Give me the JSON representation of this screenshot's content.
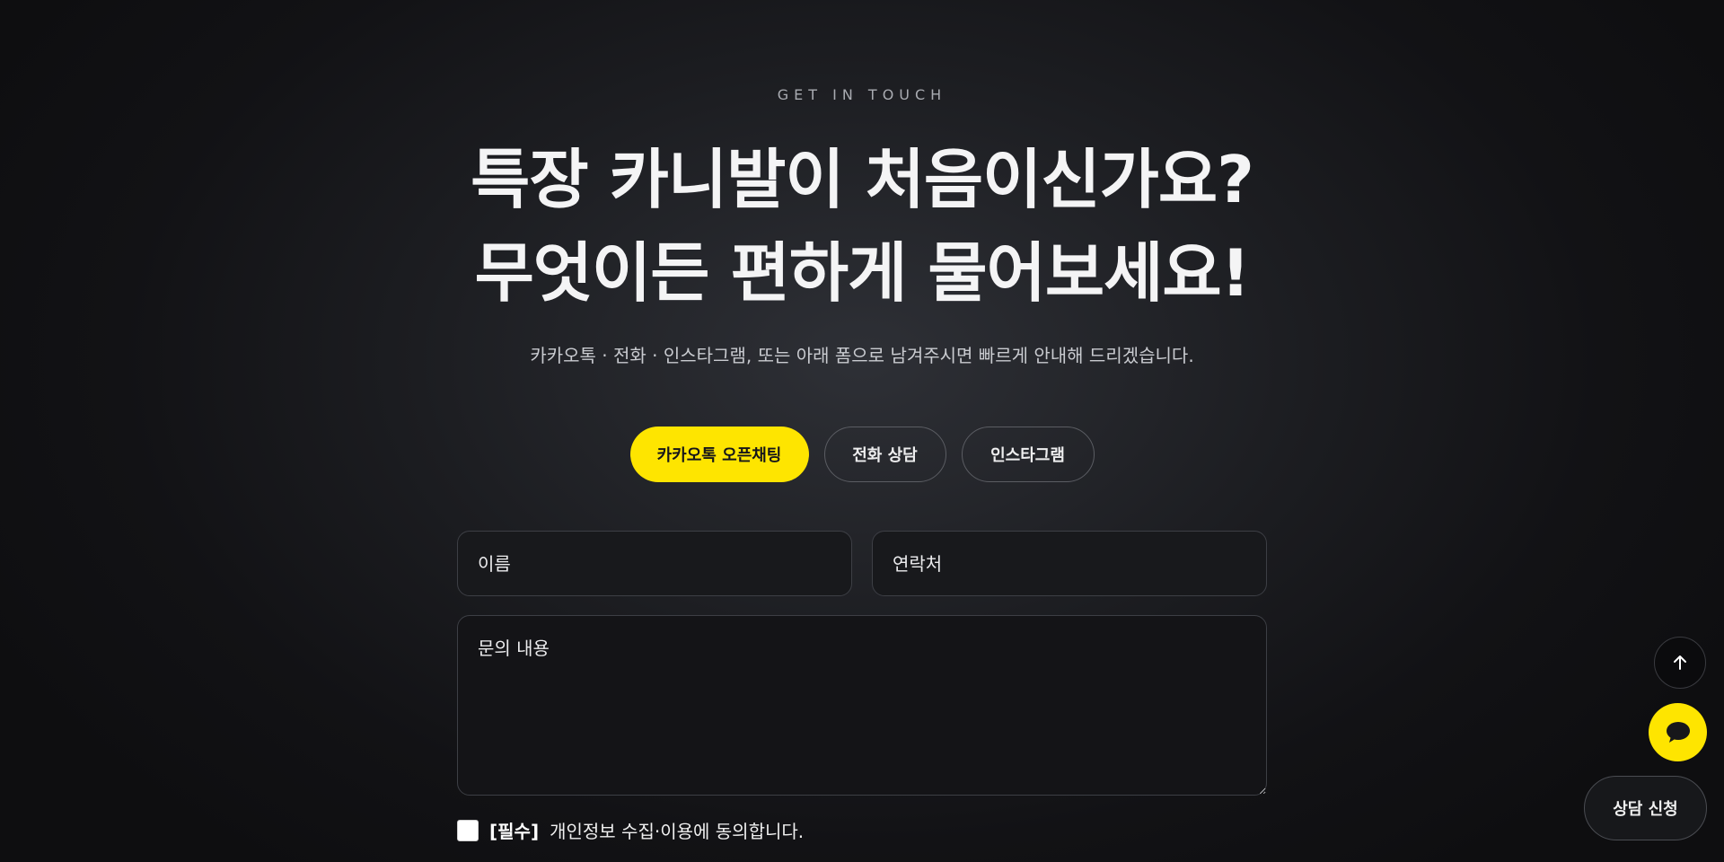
{
  "hero": {
    "eyebrow": "GET IN TOUCH",
    "headline_line1": "특장 카니발이 처음이신가요?",
    "headline_line2": "무엇이든 편하게 물어보세요!",
    "subtitle": "카카오톡 · 전화 · 인스타그램, 또는 아래 폼으로 남겨주시면 빠르게 안내해 드리겠습니다."
  },
  "channels": {
    "kakao_label": "카카오톡 오픈채팅",
    "phone_label": "전화 상담",
    "instagram_label": "인스타그램"
  },
  "form": {
    "name_placeholder": "이름",
    "contact_placeholder": "연락처",
    "message_placeholder": "문의 내용",
    "consent_required": "[필수]",
    "consent_text": "개인정보 수집·이용에 동의합니다.",
    "consent_checked": false
  },
  "floating": {
    "scroll_top_icon": "arrow-up-icon",
    "chat_icon": "chat-bubble-icon",
    "consult_label": "상담 신청"
  },
  "colors": {
    "accent": "#FEE500",
    "background": "#121215",
    "text": "#F4F4F5"
  }
}
